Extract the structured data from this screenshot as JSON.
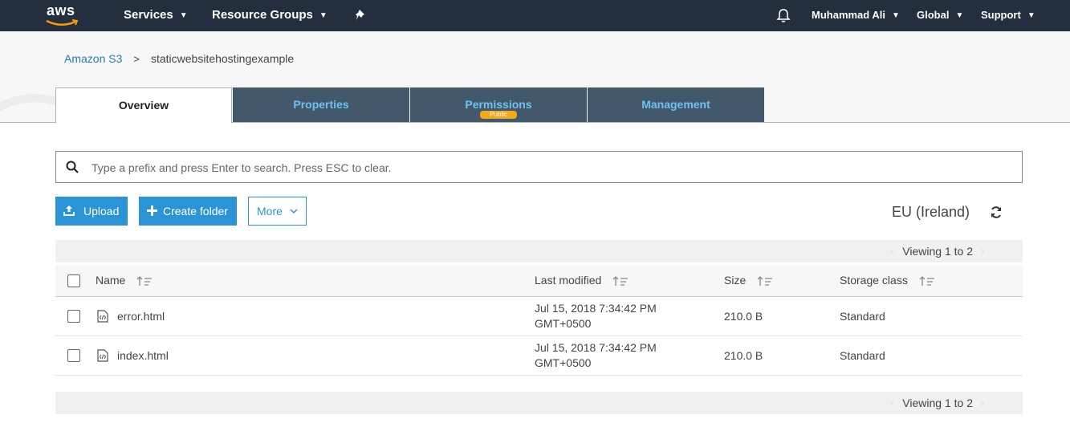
{
  "nav": {
    "logo": "aws",
    "services": "Services",
    "resource_groups": "Resource Groups",
    "pin_icon": "pin-icon",
    "bell_icon": "bell-icon",
    "user": "Muhammad Ali",
    "region": "Global",
    "support": "Support"
  },
  "breadcrumb": {
    "root": "Amazon S3",
    "separator": ">",
    "bucket": "staticwebsitehostingexample"
  },
  "tabs": [
    {
      "label": "Overview",
      "active": true
    },
    {
      "label": "Properties",
      "active": false
    },
    {
      "label": "Permissions",
      "active": false,
      "badge": "Public"
    },
    {
      "label": "Management",
      "active": false
    }
  ],
  "search": {
    "placeholder": "Type a prefix and press Enter to search. Press ESC to clear.",
    "value": ""
  },
  "toolbar": {
    "upload": "Upload",
    "create_folder": "Create folder",
    "more": "More",
    "region": "EU (Ireland)"
  },
  "table": {
    "viewing_top": "Viewing 1 to 2",
    "viewing_bottom": "Viewing 1 to 2",
    "columns": [
      "Name",
      "Last modified",
      "Size",
      "Storage class"
    ],
    "rows": [
      {
        "name": "error.html",
        "modified_line1": "Jul 15, 2018 7:34:42 PM",
        "modified_line2": "GMT+0500",
        "size": "210.0 B",
        "storage": "Standard"
      },
      {
        "name": "index.html",
        "modified_line1": "Jul 15, 2018 7:34:42 PM",
        "modified_line2": "GMT+0500",
        "size": "210.0 B",
        "storage": "Standard"
      }
    ]
  },
  "colors": {
    "nav_bg": "#232f3e",
    "tab_dark": "#44586c",
    "tab_text": "#6cc3f2",
    "primary": "#2a94d6",
    "link": "#2a7ab5",
    "badge": "#f4a91d"
  }
}
